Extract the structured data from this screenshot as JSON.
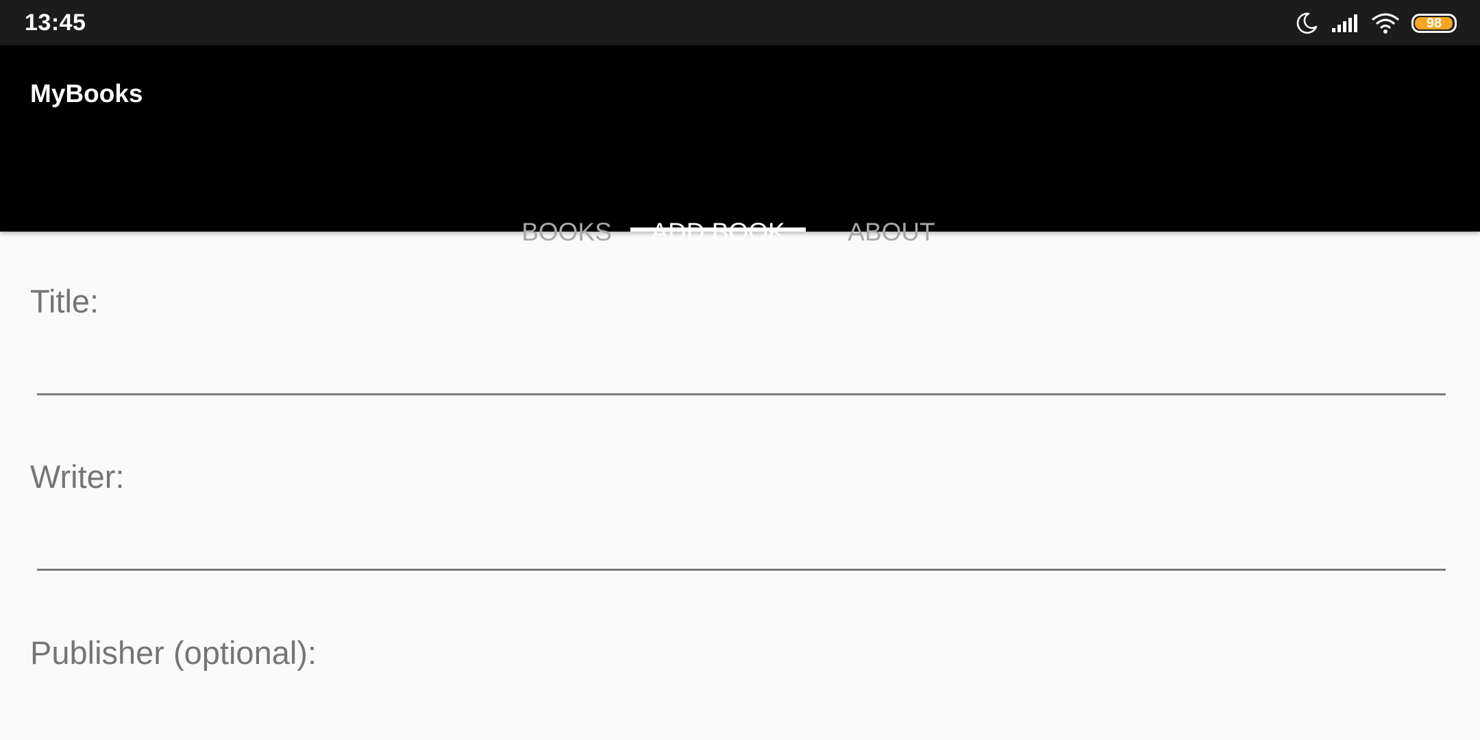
{
  "status_bar": {
    "time": "13:45",
    "battery_level": "98",
    "battery_color": "#f5a623",
    "icons": [
      "moon-icon",
      "signal-icon",
      "wifi-icon",
      "battery-icon"
    ]
  },
  "app_bar": {
    "title": "MyBooks"
  },
  "tabs": [
    {
      "label": "BOOKS",
      "active": false
    },
    {
      "label": "ADD BOOK",
      "active": true
    },
    {
      "label": "ABOUT",
      "active": false
    }
  ],
  "form": {
    "title_label": "Title:",
    "title_value": "",
    "writer_label": "Writer:",
    "writer_value": "",
    "publisher_label": "Publisher (optional):"
  },
  "colors": {
    "app_bar_bg": "#000000",
    "status_bar_bg": "#1c1c1c",
    "inactive_tab_text": "#a8a8a8",
    "active_tab_text": "#ffffff",
    "label_text": "#757575",
    "page_bg": "#fafafa"
  }
}
